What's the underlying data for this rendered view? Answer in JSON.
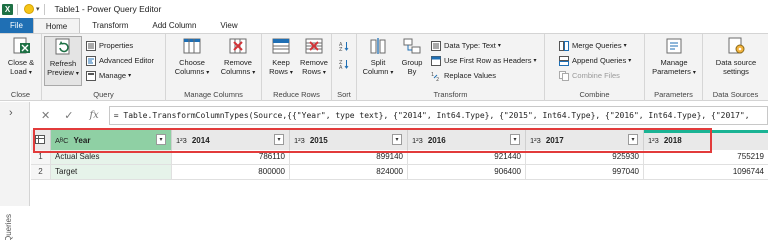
{
  "window": {
    "title": "Table1 - Power Query Editor"
  },
  "tabs": [
    {
      "label": "File"
    },
    {
      "label": "Home"
    },
    {
      "label": "Transform"
    },
    {
      "label": "Add Column"
    },
    {
      "label": "View"
    }
  ],
  "ribbon": {
    "close": {
      "close_load": "Close &",
      "close_load2": "Load",
      "group": "Close"
    },
    "query": {
      "refresh": "Refresh",
      "preview": "Preview",
      "properties": "Properties",
      "advanced_editor": "Advanced Editor",
      "manage": "Manage",
      "group": "Query"
    },
    "manage_columns": {
      "choose": "Choose",
      "choose2": "Columns",
      "remove": "Remove",
      "remove2": "Columns",
      "group": "Manage Columns"
    },
    "reduce_rows": {
      "keep": "Keep",
      "keep2": "Rows",
      "remove": "Remove",
      "remove2": "Rows",
      "group": "Reduce Rows"
    },
    "sort": {
      "group": "Sort"
    },
    "transform": {
      "split": "Split",
      "split2": "Column",
      "group_by": "Group",
      "group_by2": "By",
      "data_type": "Data Type: Text",
      "first_row": "Use First Row as Headers",
      "replace": "Replace Values",
      "group": "Transform"
    },
    "combine": {
      "merge": "Merge Queries",
      "append": "Append Queries",
      "combine_files": "Combine Files",
      "group": "Combine"
    },
    "parameters": {
      "manage": "Manage",
      "manage2": "Parameters",
      "group": "Parameters"
    },
    "data_sources": {
      "settings": "Data source",
      "settings2": "settings",
      "group": "Data Sources"
    }
  },
  "left_pane": {
    "label": "Queries"
  },
  "formula": "= Table.TransformColumnTypes(Source,{{\"Year\", type text}, {\"2014\", Int64.Type}, {\"2015\", Int64.Type}, {\"2016\", Int64.Type}, {\"2017\",",
  "table": {
    "columns": [
      {
        "name": "Year",
        "type_icon": "AᴮC"
      },
      {
        "name": "2014",
        "type_icon": "1²3"
      },
      {
        "name": "2015",
        "type_icon": "1²3"
      },
      {
        "name": "2016",
        "type_icon": "1²3"
      },
      {
        "name": "2017",
        "type_icon": "1²3"
      },
      {
        "name": "2018",
        "type_icon": "1²3"
      }
    ],
    "rows": [
      {
        "num": "1",
        "cells": [
          "Actual Sales",
          "786110",
          "899140",
          "921440",
          "925930",
          "755219"
        ]
      },
      {
        "num": "2",
        "cells": [
          "Target",
          "800000",
          "824000",
          "906400",
          "997040",
          "1096744"
        ]
      }
    ]
  },
  "colors": {
    "selected_column": "#8fd0a4",
    "highlight_border": "#e23b3b",
    "file_tab": "#1f6fb4"
  }
}
